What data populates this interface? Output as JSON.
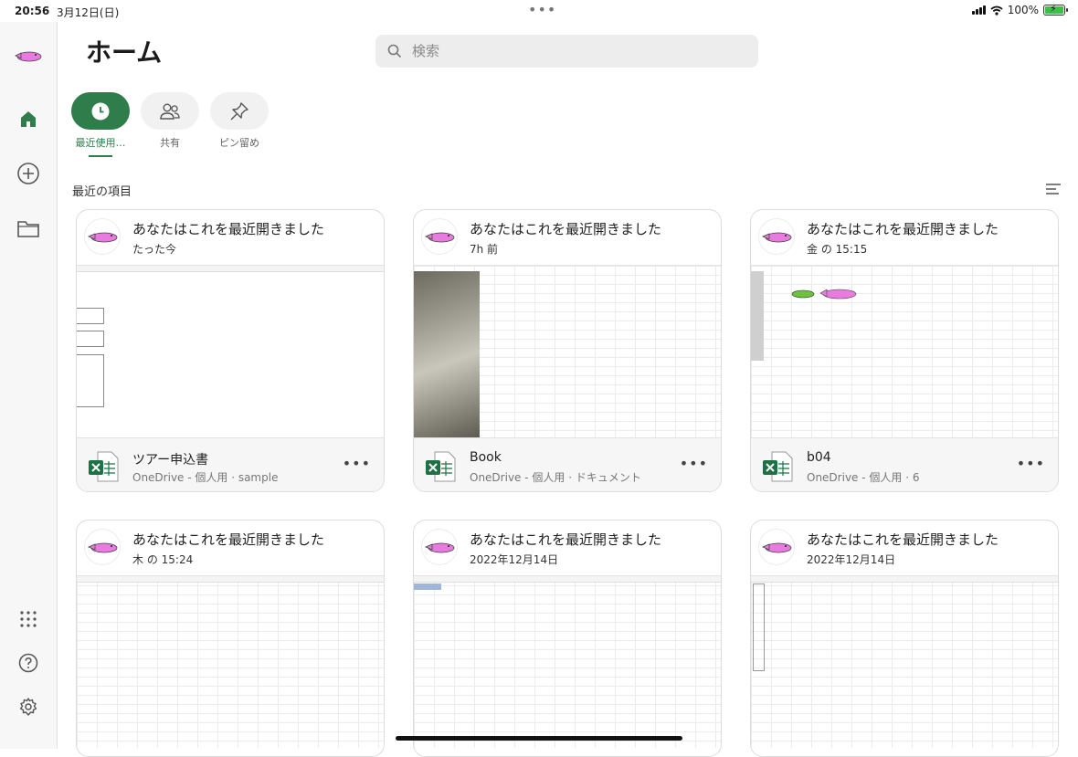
{
  "status": {
    "time": "20:56",
    "date": "3月12日(日)",
    "dots": "•••",
    "battery": "100%"
  },
  "sidebar": {
    "items": [
      "avatar",
      "home-icon",
      "add-icon",
      "folder-icon",
      "apps-grid-icon",
      "help-icon",
      "settings-icon"
    ]
  },
  "header": {
    "title": "ホーム",
    "search_placeholder": "検索"
  },
  "tabs": [
    {
      "label": "最近使用…",
      "icon": "clock-icon",
      "active": true
    },
    {
      "label": "共有",
      "icon": "people-icon",
      "active": false
    },
    {
      "label": "ピン留め",
      "icon": "pin-icon",
      "active": false
    }
  ],
  "section": {
    "title": "最近の項目"
  },
  "cards": [
    {
      "title": "あなたはこれを最近開きました",
      "time": "たった今",
      "name": "ツアー申込書",
      "path": "OneDrive - 個人用 · sample"
    },
    {
      "title": "あなたはこれを最近開きました",
      "time": "7h 前",
      "name": "Book",
      "path": "OneDrive - 個人用 · ドキュメント"
    },
    {
      "title": "あなたはこれを最近開きました",
      "time": "金 の 15:15",
      "name": "b04",
      "path": "OneDrive - 個人用 · 6"
    },
    {
      "title": "あなたはこれを最近開きました",
      "time": "木 の 15:24"
    },
    {
      "title": "あなたはこれを最近開きました",
      "time": "2022年12月14日"
    },
    {
      "title": "あなたはこれを最近開きました",
      "time": "2022年12月14日"
    }
  ],
  "colors": {
    "accent": "#2e7d4a",
    "avatar_pink": "#e97ae0",
    "excel_green": "#1e7145"
  }
}
